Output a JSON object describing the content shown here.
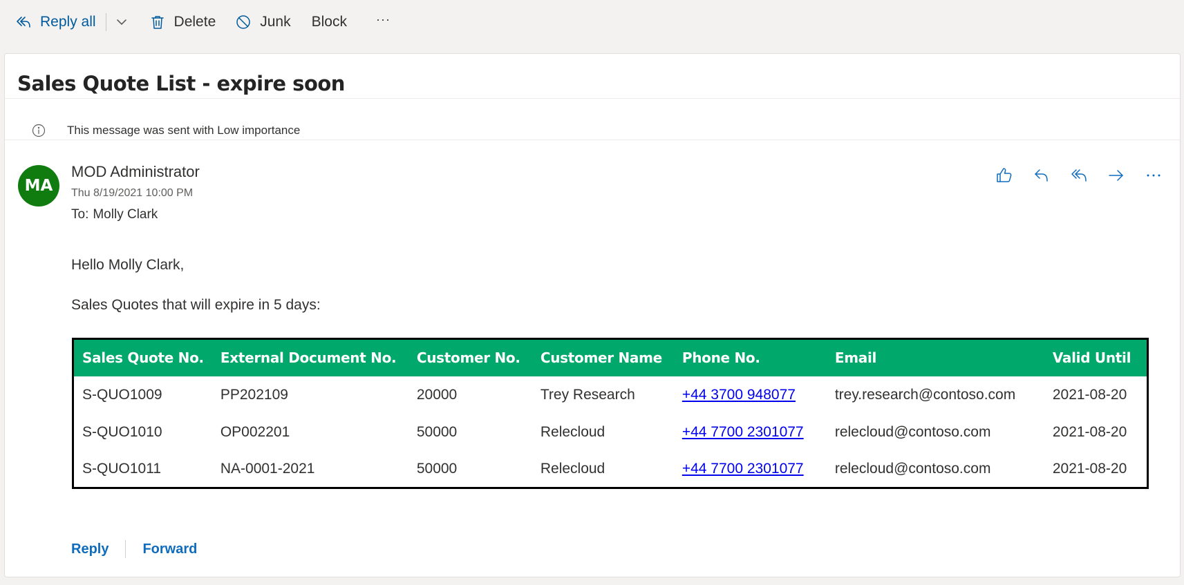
{
  "toolbar": {
    "reply_all": "Reply all",
    "delete": "Delete",
    "junk": "Junk",
    "block": "Block",
    "more": "···"
  },
  "message": {
    "subject": "Sales Quote List - expire soon",
    "importance_note": "This message was sent with Low importance",
    "avatar_initials": "MA",
    "avatar_color": "#107c10",
    "sender": "MOD Administrator",
    "date": "Thu 8/19/2021 10:00 PM",
    "to_label": "To:",
    "to_name": "Molly Clark",
    "greeting": "Hello Molly Clark,",
    "intro": "Sales Quotes that will expire in 5 days:"
  },
  "table": {
    "header_color": "#00a86b",
    "columns": [
      "Sales Quote No.",
      "External Document No.",
      "Customer No.",
      "Customer Name",
      "Phone No.",
      "Email",
      "Valid Until"
    ],
    "rows": [
      [
        "S-QUO1009",
        "PP202109",
        "20000",
        "Trey Research",
        "+44 3700 948077",
        "trey.research@contoso.com",
        "2021-08-20"
      ],
      [
        "S-QUO1010",
        "OP002201",
        "50000",
        "Relecloud",
        "+44 7700 2301077",
        "relecloud@contoso.com",
        "2021-08-20"
      ],
      [
        "S-QUO1011",
        "NA-0001-2021",
        "50000",
        "Relecloud",
        "+44 7700 2301077",
        "relecloud@contoso.com",
        "2021-08-20"
      ]
    ]
  },
  "footer": {
    "reply": "Reply",
    "forward": "Forward"
  },
  "icons": {
    "reply_all": "reply-all-icon",
    "delete": "trash-icon",
    "junk": "block-circle-icon",
    "like": "thumbs-up-icon",
    "reply": "reply-icon",
    "forward": "forward-arrow-icon",
    "more": "more-icon",
    "info": "info-icon"
  }
}
